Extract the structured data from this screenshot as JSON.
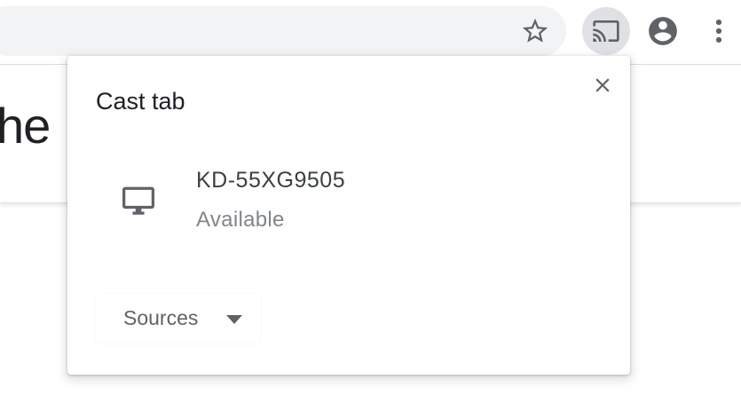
{
  "toolbar": {
    "icons": {
      "bookmark": "star-outline-icon",
      "cast": "cast-icon",
      "profile": "account-circle-icon",
      "menu": "more-vert-icon"
    }
  },
  "page": {
    "visible_text": "he"
  },
  "cast_dialog": {
    "title": "Cast tab",
    "close_icon": "close-icon",
    "sinks": [
      {
        "icon": "tv-icon",
        "name": "KD-55XG9505",
        "status": "Available"
      }
    ],
    "sources_label": "Sources",
    "sources_icon": "arrow-drop-down-icon"
  },
  "colors": {
    "omnibox_bg": "#f1f3f4",
    "cast_button_active_bg": "#dfe1e5",
    "icon": "#5f6368",
    "title_text": "#202124",
    "secondary_text": "#80868b"
  }
}
